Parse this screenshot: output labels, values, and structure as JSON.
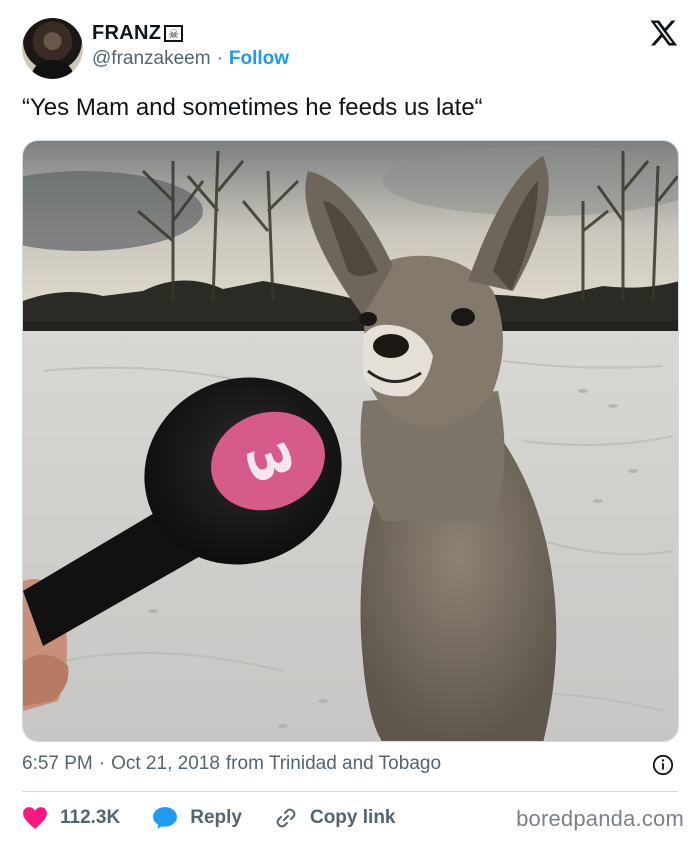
{
  "author": {
    "name": "FRANZ",
    "badge_icon": "skull-crossbones-icon",
    "handle": "@franzakeem",
    "separator": "·",
    "follow_label": "Follow"
  },
  "tweet": {
    "text": "“Yes Mam and sometimes he feeds us late“",
    "media_number": "3"
  },
  "meta": {
    "time": "6:57 PM",
    "separator": "·",
    "date": "Oct 21, 2018",
    "location": "from Trinidad and Tobago"
  },
  "actions": {
    "like_count": "112.3K",
    "reply_label": "Reply",
    "copy_label": "Copy link"
  },
  "watermark": "boredpanda.com",
  "colors": {
    "accent": "#1d9bf0",
    "like": "#f91880",
    "text": "#0f1419",
    "muted": "#536471"
  }
}
